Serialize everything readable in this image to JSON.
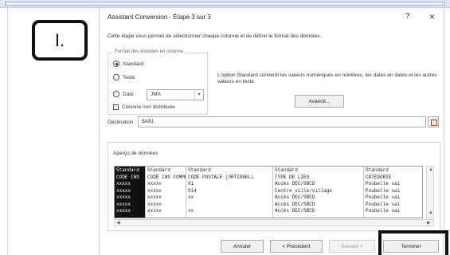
{
  "step_marker": {
    "label": "I."
  },
  "dialog": {
    "title": "Assistant Conversion - Étape 3 sur 3",
    "help_label": "?",
    "close_label": "×",
    "intro": "Cette étape vous permet de sélectionner chaque colonne et de définir le format des données."
  },
  "column_format": {
    "legend": "Format des données en colonne",
    "options": {
      "standard": "Standard",
      "texte": "Texte",
      "date": "Date :",
      "skip": "Colonne non distribuée"
    },
    "date_value": "JMA",
    "selected": "standard"
  },
  "description": "L'option Standard convertit les valeurs numériques en nombres, les dates en dates et les autres valeurs en texte.",
  "advanced_button": "Avancé...",
  "destination": {
    "label": "Destination :",
    "value": "$A$1"
  },
  "preview": {
    "legend": "Aperçu de données",
    "headers": [
      "Standard",
      "Standard",
      "Standard",
      "Standard",
      "Standard"
    ],
    "rows": [
      [
        "CODE INS",
        "CODE INS COMMUNE",
        "CODE POSTALE (ORTIONELL",
        "TYPE DE LIEU",
        "CATÉGORIE"
      ],
      [
        "xxxxx",
        "xxxxx",
        "01",
        "Accès DEC/SBCD",
        "Poubelle sai"
      ],
      [
        "xxxxx",
        "xxxxx",
        "014",
        "Centre ville/village",
        "Poubelle sai"
      ],
      [
        "xxxxx",
        "xxxxx",
        "xx",
        "Accès DEC/SBCD",
        "Poubelle sai"
      ],
      [
        "xxxxx",
        "xxxxx",
        "",
        "Accès DEC/SBCD",
        "Poubelle sai"
      ],
      [
        "xxxxx",
        "xxxxx",
        "xx",
        "Accès DEC/SBCD",
        "Poubelle sai"
      ]
    ]
  },
  "buttons": {
    "cancel": "Annuler",
    "previous": "< Précédent",
    "next": "Suivant >",
    "finish": "Terminer"
  },
  "colors": {
    "highlight": "#111111",
    "selected_column": "#111111"
  }
}
